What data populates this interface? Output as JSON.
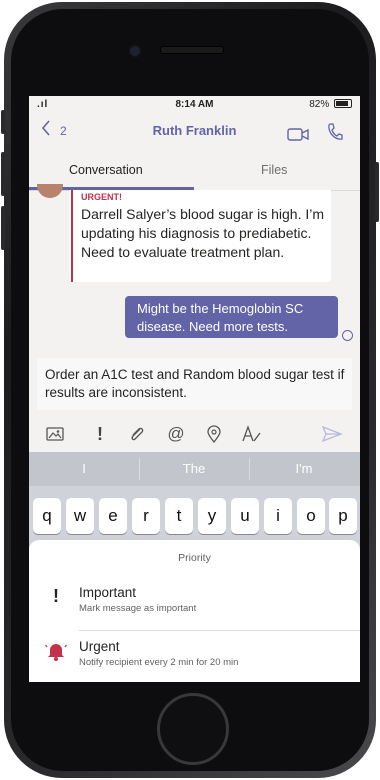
{
  "status_bar": {
    "signal": ".ıl",
    "time": "8:14 AM",
    "battery": "82%"
  },
  "header": {
    "back_count": "2",
    "title": "Ruth Franklin"
  },
  "tabs": [
    {
      "label": "Conversation"
    },
    {
      "label": "Files"
    }
  ],
  "messages": {
    "incoming": {
      "priority": "URGENT!",
      "text": "Darrell Salyer’s blood sugar is high. I’m updating his diagnosis to prediabetic. Need to evaluate treatment plan."
    },
    "outgoing": {
      "text": "Might be the Hemoglobin SC disease. Need more tests."
    }
  },
  "compose": {
    "text": "Order an A1C test and Random blood sugar test if results are inconsistent."
  },
  "toolbar": {
    "icons": [
      "image-icon",
      "priority-icon",
      "attach-icon",
      "mention-icon",
      "location-icon",
      "format-icon",
      "send-icon"
    ],
    "priority_glyph": "!",
    "mention_glyph": "@"
  },
  "suggestions": [
    "I",
    "The",
    "I'm"
  ],
  "keyboard": {
    "row1": [
      "q",
      "w",
      "e",
      "r",
      "t",
      "y",
      "u",
      "i",
      "o",
      "p"
    ]
  },
  "priority_sheet": {
    "title": "Priority",
    "options": [
      {
        "icon": "!",
        "title": "Important",
        "subtitle": "Mark message as important"
      },
      {
        "title": "Urgent",
        "subtitle": "Notify recipient every 2 min for 20 min"
      }
    ]
  },
  "colors": {
    "accent": "#6264a7",
    "urgent": "#c4314b"
  }
}
